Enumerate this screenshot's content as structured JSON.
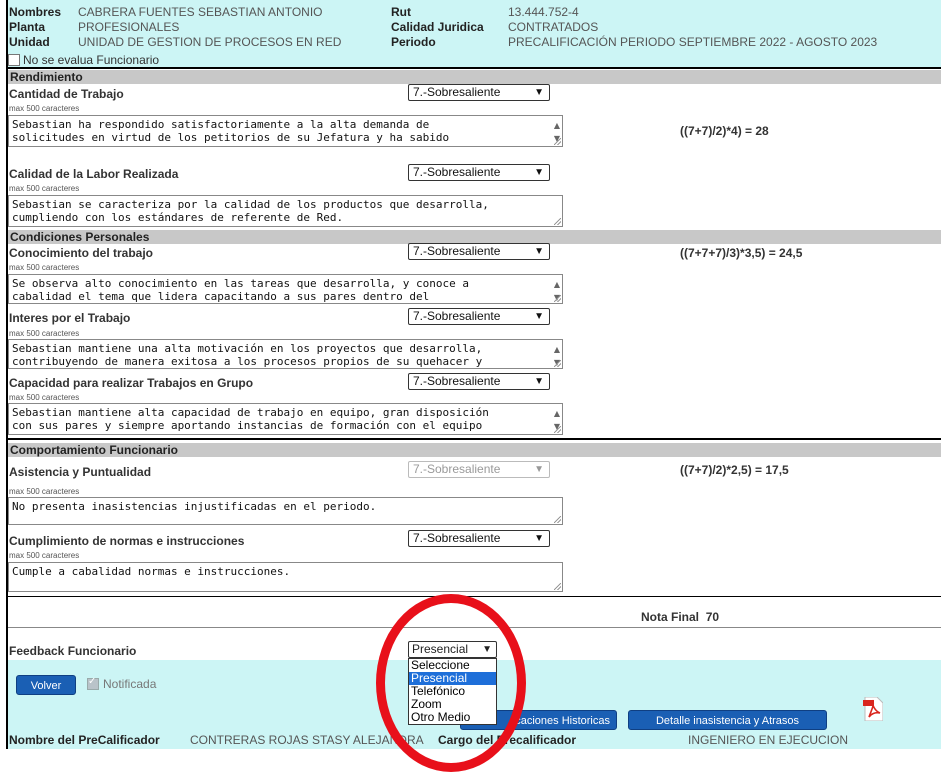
{
  "header": {
    "nombres_label": "Nombres",
    "nombres_value": "CABRERA FUENTES SEBASTIAN ANTONIO",
    "planta_label": "Planta",
    "planta_value": "PROFESIONALES",
    "unidad_label": "Unidad",
    "unidad_value": "UNIDAD DE GESTION DE PROCESOS EN RED",
    "rut_label": "Rut",
    "rut_value": "13.444.752-4",
    "calidad_label": "Calidad Juridica",
    "calidad_value": "CONTRATADOS",
    "periodo_label": "Periodo",
    "periodo_value": "PRECALIFICACIÓN PERIODO SEPTIEMBRE 2022 - AGOSTO 2023"
  },
  "no_evalua": "No se evalua Funcionario",
  "max_chars": "max 500 caracteres",
  "sections": {
    "rendimiento": "Rendimiento",
    "condiciones": "Condiciones Personales",
    "comportamiento": "Comportamiento Funcionario"
  },
  "items": {
    "cantidad": {
      "label": "Cantidad de Trabajo",
      "grade": "7.-Sobresaliente",
      "text": "Sebastian ha respondido satisfactoriamente a la alta demanda de\nsolicitudes en virtud de los petitorios de su Jefatura y ha sabido"
    },
    "calidad": {
      "label": "Calidad de la Labor Realizada",
      "grade": "7.-Sobresaliente",
      "text": "Sebastian se caracteriza por la calidad de los productos que desarrolla,\ncumpliendo con los estándares de referente de Red."
    },
    "conocimiento": {
      "label": "Conocimiento del trabajo",
      "grade": "7.-Sobresaliente",
      "text": "Se observa alto conocimiento en las tareas que desarrolla, y conoce a\ncabalidad el tema que lidera capacitando a sus pares dentro del"
    },
    "interes": {
      "label": "Interes por el Trabajo",
      "grade": "7.-Sobresaliente",
      "text": "Sebastian mantiene una alta motivación en los proyectos que desarrolla,\ncontribuyendo de manera exitosa a los procesos propios de su quehacer y"
    },
    "grupo": {
      "label": "Capacidad para realizar Trabajos en Grupo",
      "grade": "7.-Sobresaliente",
      "text": "Sebastian mantiene alta capacidad de trabajo en equipo, gran disposición\ncon sus pares y siempre aportando instancias de formación con el equipo"
    },
    "asistencia": {
      "label": "Asistencia y Puntualidad",
      "grade": "7.-Sobresaliente",
      "text": "No presenta inasistencias injustificadas en el periodo."
    },
    "cumplimiento": {
      "label": "Cumplimiento de normas e instrucciones",
      "grade": "7.-Sobresaliente",
      "text": "Cumple a cabalidad normas e instrucciones."
    }
  },
  "formulas": {
    "rendimiento": "((7+7)/2)*4) = 28",
    "condiciones": "((7+7+7)/3)*3,5) = 24,5",
    "comportamiento": "((7+7)/2)*2,5) = 17,5"
  },
  "nota_final_label": "Nota Final",
  "nota_final_value": "70",
  "feedback": {
    "label": "Feedback Funcionario",
    "selected": "Presencial",
    "options": [
      "Seleccione",
      "Presencial",
      "Telefónico",
      "Zoom",
      "Otro Medio"
    ]
  },
  "buttons": {
    "volver": "Volver",
    "historicas": "icaciones Historicas",
    "inasistencia": "Detalle inasistencia y Atrasos"
  },
  "notificada": "Notificada",
  "footer": {
    "precalificador_label": "Nombre del PreCalificador",
    "precalificador_value": "CONTRERAS ROJAS STASY ALEJANDRA",
    "cargo_label": "Cargo del Precalificador",
    "cargo_value": "INGENIERO EN EJECUCION"
  },
  "colors": {
    "header_bg": "#ccf5f5",
    "section_bg": "#c8c8c8",
    "button_blue": "#1a5fb4",
    "highlight_circle": "#e8101a"
  }
}
